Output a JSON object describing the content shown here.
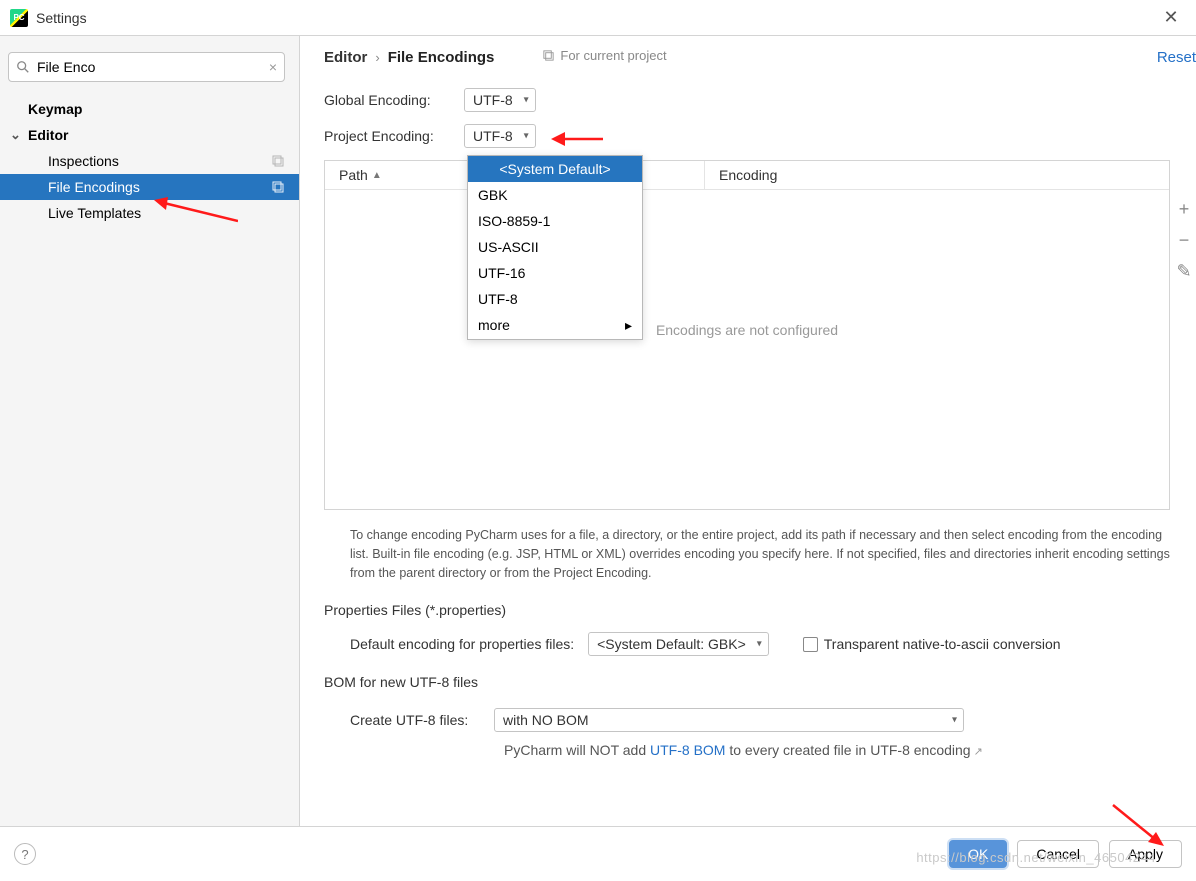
{
  "window": {
    "title": "Settings"
  },
  "search": {
    "value": "File Enco"
  },
  "sidebar": {
    "items": [
      {
        "label": "Keymap"
      },
      {
        "label": "Editor"
      },
      {
        "label": "Inspections"
      },
      {
        "label": "File Encodings"
      },
      {
        "label": "Live Templates"
      }
    ]
  },
  "breadcrumb": {
    "parent": "Editor",
    "current": "File Encodings",
    "scope": "For current project",
    "reset": "Reset"
  },
  "globalEncoding": {
    "label": "Global Encoding:",
    "value": "UTF-8"
  },
  "projectEncoding": {
    "label": "Project Encoding:",
    "value": "UTF-8"
  },
  "encodingPopup": {
    "items": [
      "<System Default>",
      "GBK",
      "ISO-8859-1",
      "US-ASCII",
      "UTF-16",
      "UTF-8",
      "more"
    ]
  },
  "table": {
    "col_path": "Path",
    "col_encoding": "Encoding",
    "empty": "Encodings are not configured"
  },
  "help": "To change encoding PyCharm uses for a file, a directory, or the entire project, add its path if necessary and then select encoding from the encoding list. Built-in file encoding (e.g. JSP, HTML or XML) overrides encoding you specify here. If not specified, files and directories inherit encoding settings from the parent directory or from the Project Encoding.",
  "propSection": {
    "title": "Properties Files (*.properties)",
    "label": "Default encoding for properties files:",
    "value": "<System Default: GBK>",
    "checkbox": "Transparent native-to-ascii conversion"
  },
  "bomSection": {
    "title": "BOM for new UTF-8 files",
    "label": "Create UTF-8 files:",
    "value": "with NO BOM",
    "note_pre": "PyCharm will NOT add ",
    "note_link": "UTF-8 BOM",
    "note_post": " to every created file in UTF-8 encoding"
  },
  "footer": {
    "ok": "OK",
    "cancel": "Cancel",
    "apply": "Apply"
  },
  "watermark": "https://blog.csdn.net/weixin_46504244"
}
